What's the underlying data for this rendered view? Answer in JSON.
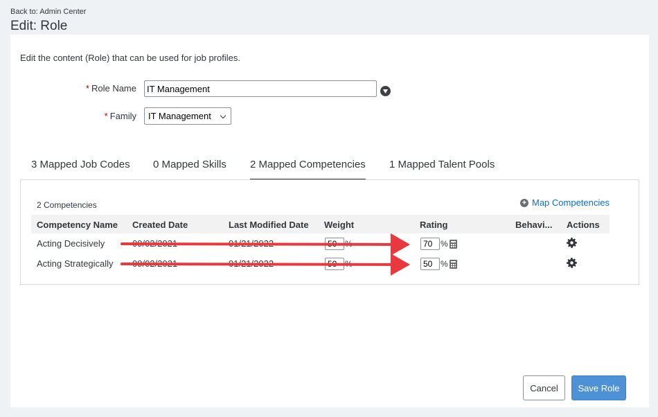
{
  "header": {
    "back_link": "Back to: Admin Center",
    "title": "Edit: Role"
  },
  "form": {
    "description": "Edit the content (Role) that can be used for job profiles.",
    "required_mark": "*",
    "role_name_label": "Role Name",
    "role_name_value": "IT Management",
    "family_label": "Family",
    "family_value": "IT Management"
  },
  "tabs": [
    {
      "label": "3 Mapped Job Codes",
      "active": false
    },
    {
      "label": "0 Mapped Skills",
      "active": false
    },
    {
      "label": "2 Mapped Competencies",
      "active": true
    },
    {
      "label": "1 Mapped Talent Pools",
      "active": false
    }
  ],
  "competencies": {
    "count_label": "2 Competencies",
    "map_link": "Map Competencies",
    "columns": [
      "Competency Name",
      "Created Date",
      "Last Modified Date",
      "Weight",
      "Rating",
      "Behavi...",
      "Actions"
    ],
    "percent_sign": "%",
    "rows": [
      {
        "name": "Acting Decisively",
        "created": "09/02/2021",
        "modified": "01/21/2022",
        "weight": "50",
        "rating": "70"
      },
      {
        "name": "Acting Strategically",
        "created": "09/02/2021",
        "modified": "01/21/2022",
        "weight": "50",
        "rating": "50"
      }
    ]
  },
  "footer": {
    "cancel_label": "Cancel",
    "save_label": "Save Role"
  },
  "colors": {
    "accent": "#0a6ed1",
    "save_button": "#4d92d6",
    "required": "#bb0000",
    "annotation_arrow": "#e8393f"
  },
  "icons": [
    "help-icon",
    "chevron-down-icon",
    "plus-circle-icon",
    "calculator-icon",
    "gear-icon"
  ]
}
